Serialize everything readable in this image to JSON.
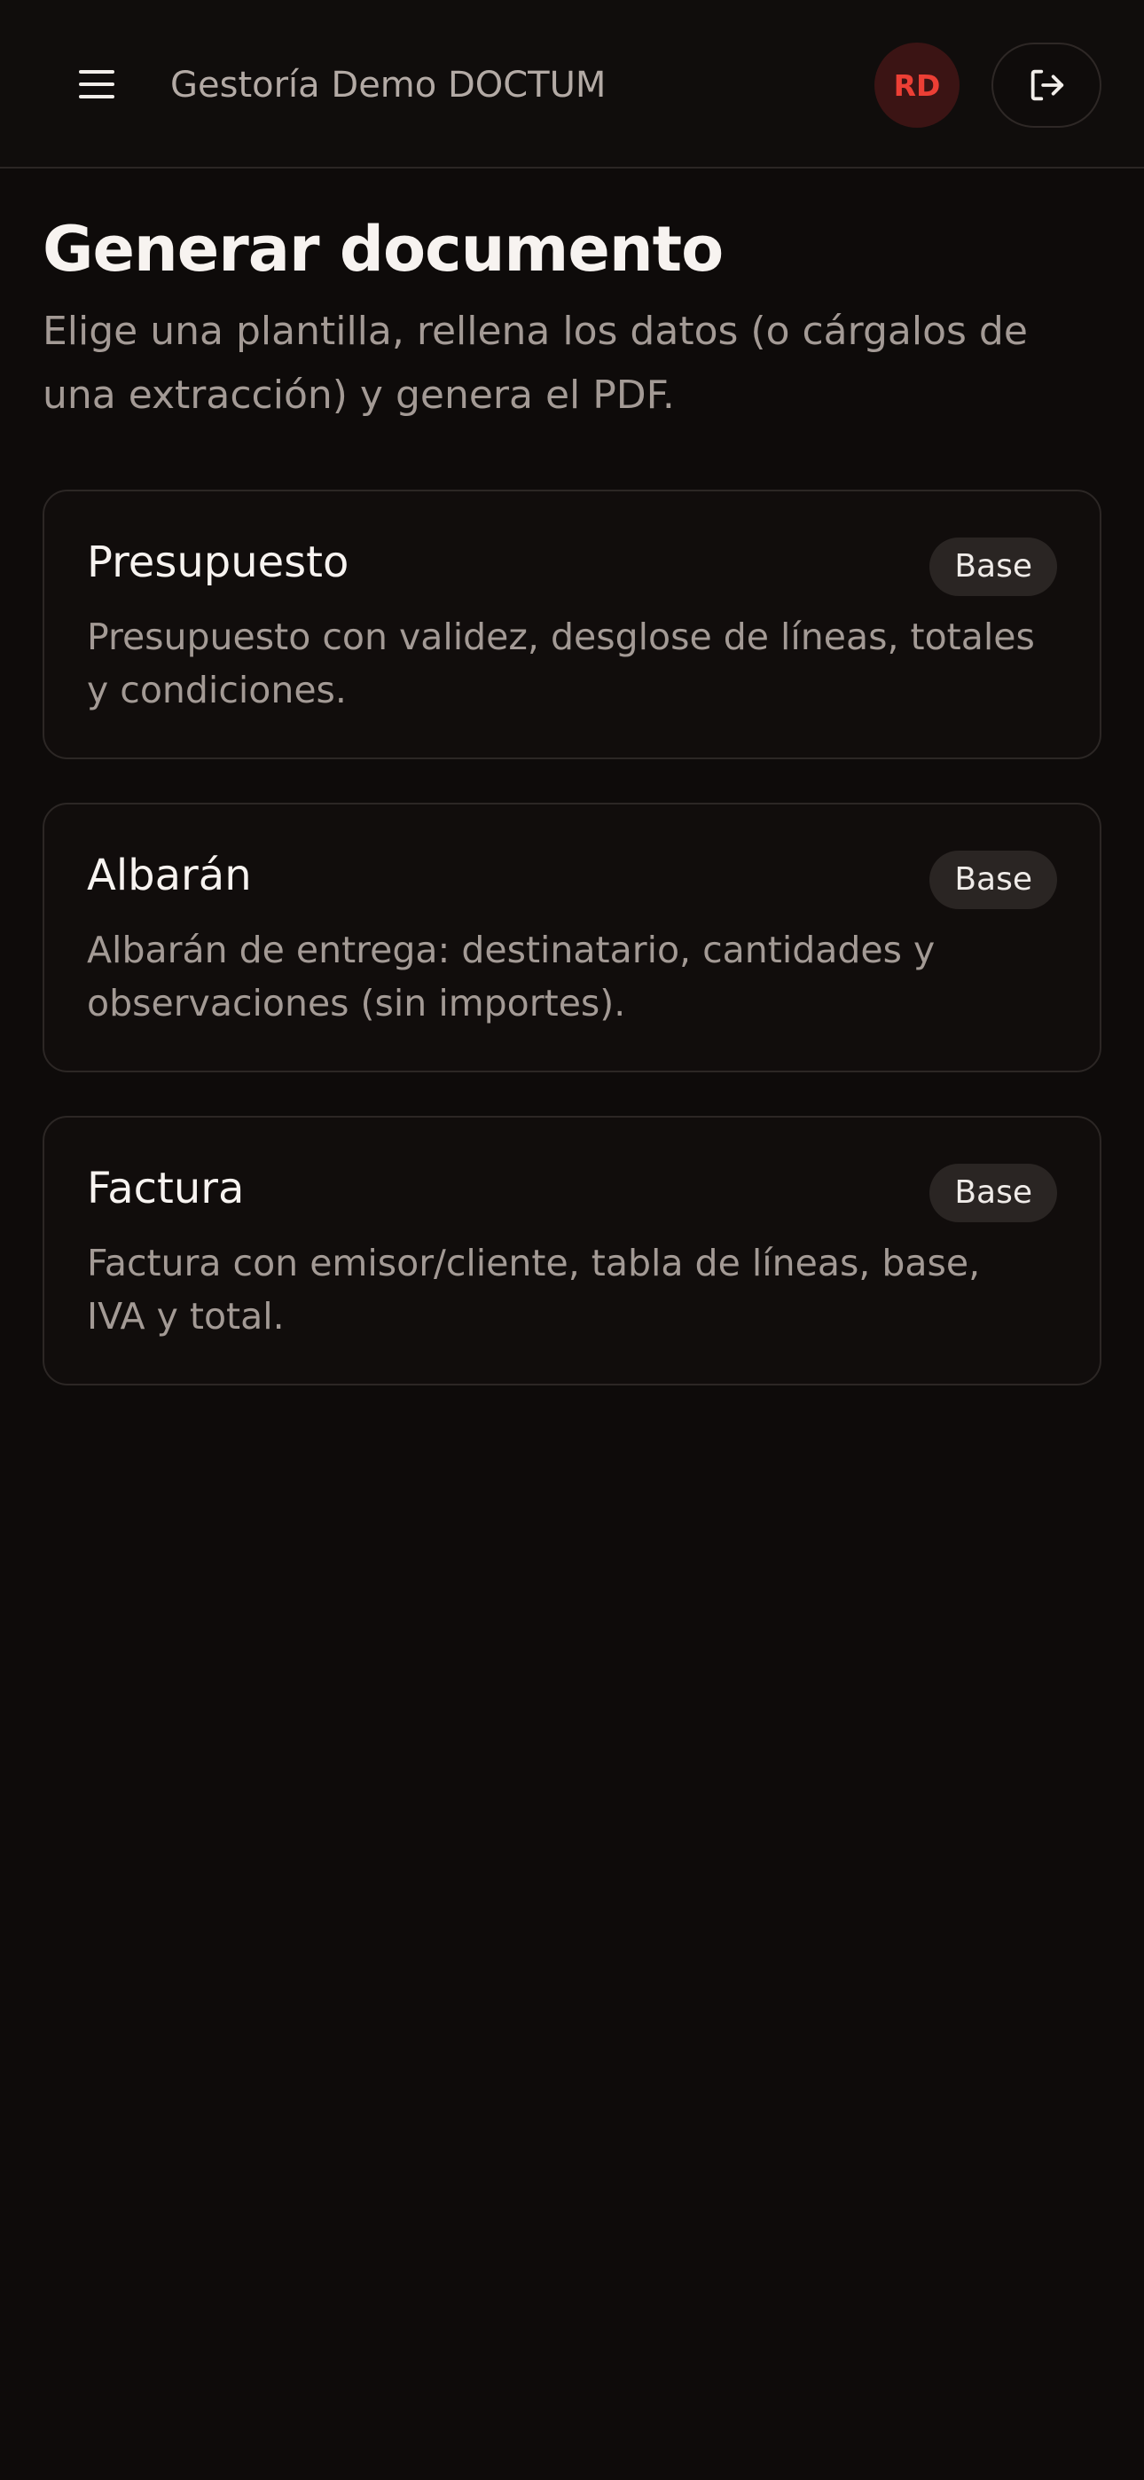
{
  "header": {
    "org_name": "Gestoría Demo DOCTUM",
    "avatar_initials": "RD"
  },
  "main": {
    "title": "Generar documento",
    "subtitle": "Elige una plantilla, rellena los datos (o cárgalos de una extracción) y genera el PDF."
  },
  "templates": [
    {
      "title": "Presupuesto",
      "badge": "Base",
      "description": "Presupuesto con validez, desglose de líneas, totales y condiciones."
    },
    {
      "title": "Albarán",
      "badge": "Base",
      "description": "Albarán de entrega: destinatario, cantidades y observaciones (sin importes)."
    },
    {
      "title": "Factura",
      "badge": "Base",
      "description": "Factura con emisor/cliente, tabla de líneas, base, IVA y total."
    }
  ],
  "icons": {
    "menu": "hamburger-menu-icon",
    "logout": "logout-icon"
  },
  "colors": {
    "background": "#0e0b0a",
    "accent": "#ec3f35",
    "avatar_bg": "#3b1414"
  }
}
